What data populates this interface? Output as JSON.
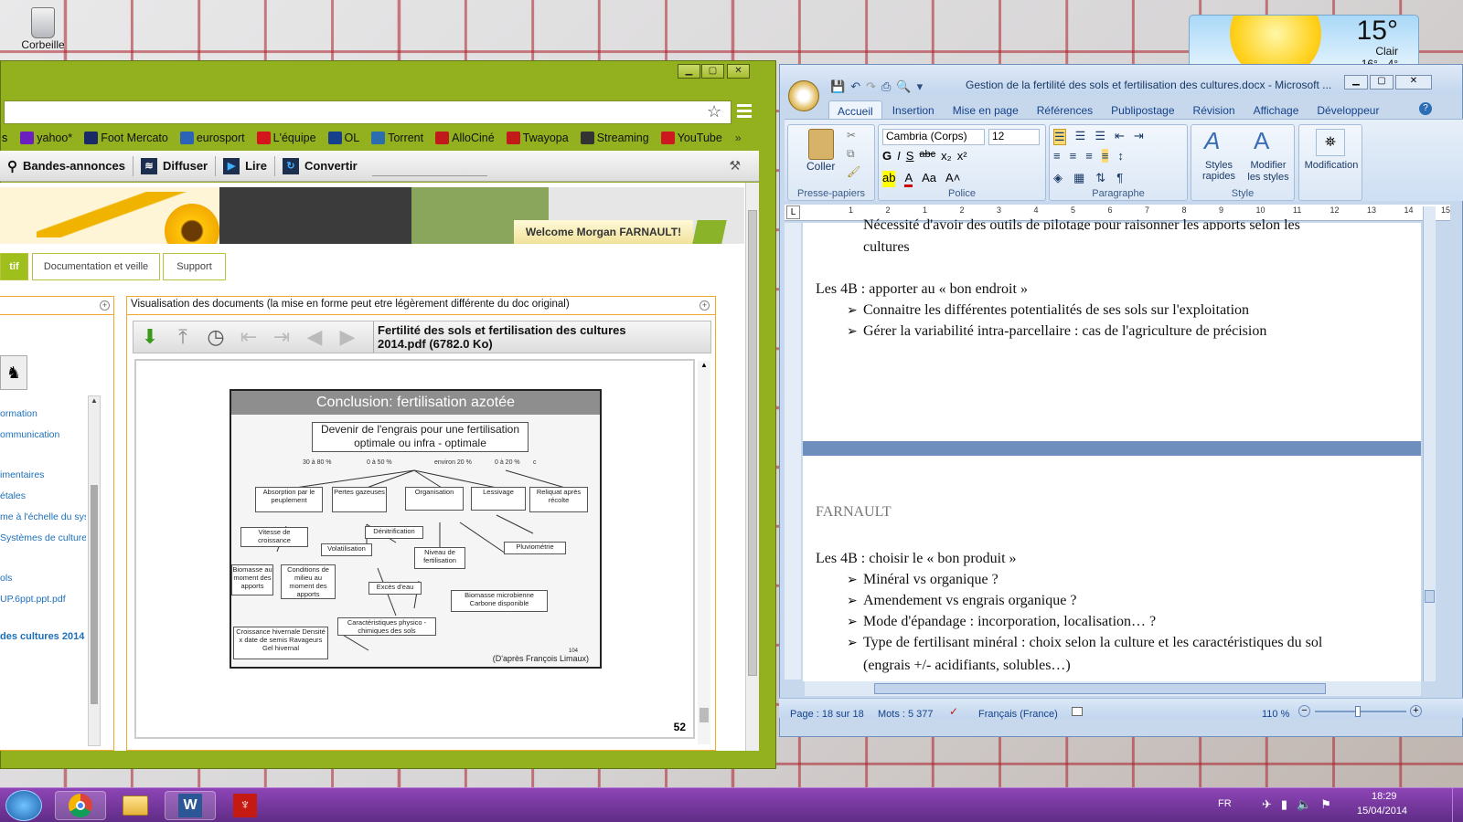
{
  "desktop": {
    "recycle_bin": "Corbeille"
  },
  "weather": {
    "temp": "15°",
    "condition": "Clair",
    "range": "16° - 4°"
  },
  "chrome": {
    "bookmarks": [
      {
        "icon": "yahoo-icon",
        "label": "yahoo*",
        "color": "#6b1fbf"
      },
      {
        "icon": "footmercato-icon",
        "label": "Foot Mercato",
        "color": "#1a2a66"
      },
      {
        "icon": "search-icon",
        "label": "eurosport",
        "color": "#2b64b6"
      },
      {
        "icon": "lequipe-icon",
        "label": "L'équipe",
        "color": "#d4151b"
      },
      {
        "icon": "ol-icon",
        "label": "OL",
        "color": "#17408c"
      },
      {
        "icon": "torrent-icon",
        "label": "Torrent",
        "color": "#2c6db0"
      },
      {
        "icon": "allocine-icon",
        "label": "AlloCiné",
        "color": "#c21a1a"
      },
      {
        "icon": "twayopa-icon",
        "label": "Twayopa",
        "color": "#c21a1a"
      },
      {
        "icon": "streaming-icon",
        "label": "Streaming",
        "color": "#333333"
      },
      {
        "icon": "youtube-icon",
        "label": "YouTube",
        "color": "#cc181e"
      }
    ],
    "bm_partial": "s",
    "toolbar": {
      "trailers": "Bandes-annonces",
      "stream": "Diffuser",
      "play": "Lire",
      "convert": "Convertir"
    },
    "banner_welcome": "Welcome Morgan FARNAULT!",
    "tabs": {
      "active": "tif",
      "doc": "Documentation et veille",
      "support": "Support"
    },
    "viewer_header": "Visualisation des documents (la mise en forme peut etre légèrement différente du doc original)",
    "file_title": "Fertilité des sols et fertilisation des cultures 2014.pdf (6782.0 Ko)",
    "page_number": "52",
    "sidebar_links": [
      "ormation",
      "ommunication",
      "imentaires",
      "étales",
      "me à l'échelle du sys",
      "Systèmes de culture",
      "ols",
      "UP.6ppt.ppt.pdf"
    ],
    "sidebar_bold": "des cultures 2014"
  },
  "slide": {
    "title": "Conclusion: fertilisation azotée",
    "top_box": "Devenir de l'engrais pour une fertilisation optimale ou infra - optimale",
    "percents": [
      "30 à 80 %",
      "0 à 50 %",
      "environ 20 %",
      "0 à 20 %",
      "c"
    ],
    "boxes": [
      "Absorption par le peuplement",
      "Pertes gazeuses",
      "Organisation",
      "Lessivage",
      "Reliquat après récolte",
      "Vitesse de croissance",
      "Dénitrification",
      "Volatilisation",
      "Niveau de fertilisation",
      "Pluviométrie",
      "Biomasse au moment des apports",
      "Conditions de milieu au moment des apports",
      "Excès d'eau",
      "Biomasse microbienne Carbone disponible",
      "Caractéristiques physico - chimiques des sols",
      "Croissance hivernale Densité x date de semis Ravageurs Gel hivernal"
    ],
    "credit": "(D'après François Limaux)",
    "slide_no": "104"
  },
  "word": {
    "title": "Gestion de la fertilité des sols et fertilisation des cultures.docx - Microsoft ...",
    "tabs": [
      "Accueil",
      "Insertion",
      "Mise en page",
      "Références",
      "Publipostage",
      "Révision",
      "Affichage",
      "Développeur"
    ],
    "font": "Cambria (Corps)",
    "size": "12",
    "groups": {
      "clipboard": "Presse-papiers",
      "paste": "Coller",
      "font": "Police",
      "paragraph": "Paragraphe",
      "style": "Style",
      "styles_quick": "Styles rapides",
      "styles_modify": "Modifier les styles",
      "edit": "Modification"
    },
    "ruler": [
      "1",
      "2",
      "1",
      "2",
      "3",
      "4",
      "5",
      "6",
      "7",
      "8",
      "9",
      "10",
      "11",
      "12",
      "13",
      "14",
      "15"
    ],
    "doc": {
      "cut_line": "Nécessité d'avoir des outils de pilotage pour raisonner les apports selon les",
      "cut_line2": "cultures",
      "h1": "Les 4B : apporter au « bon endroit »",
      "b1": [
        "Connaitre les différentes potentialités de ses sols sur l'exploitation",
        "Gérer la variabilité intra-parcellaire : cas de l'agriculture de précision"
      ],
      "header": "FARNAULT",
      "h2": "Les 4B : choisir le « bon produit »",
      "b2": [
        "Minéral vs organique ?",
        "Amendement vs engrais organique ?",
        "Mode d'épandage : incorporation, localisation… ?",
        "Type de fertilisant minéral : choix selon la culture et les caractéristiques du sol"
      ],
      "b2_cont": "(engrais +/- acidifiants, solubles…)"
    },
    "status": {
      "page": "Page : 18 sur 18",
      "words": "Mots : 5 377",
      "lang": "Français (France)",
      "zoom": "110 %"
    }
  },
  "taskbar": {
    "lang": "FR",
    "time": "18:29",
    "date": "15/04/2014"
  }
}
